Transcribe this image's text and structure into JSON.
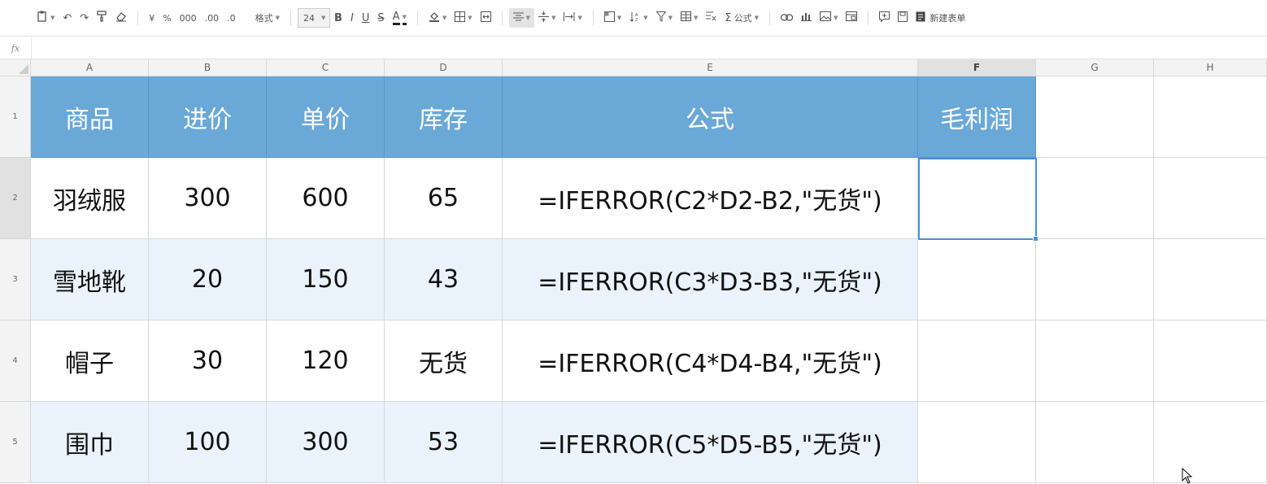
{
  "toolbar": {
    "currency": "¥",
    "percent": "%",
    "thousands": "000",
    "dec_inc": ".00",
    "dec_dec": ".0",
    "format_label": "格式",
    "font_size": "24",
    "bold": "B",
    "italic": "I",
    "underline": "U",
    "strike": "S",
    "font_color": "A",
    "formula_label": "公式",
    "new_sheet_label": "新建表单"
  },
  "formula_bar": {
    "fx": "fx",
    "content": ""
  },
  "columns": [
    "A",
    "B",
    "C",
    "D",
    "E",
    "F",
    "G",
    "H"
  ],
  "rows": [
    "1",
    "2",
    "3",
    "4",
    "5"
  ],
  "header_row": [
    "商品",
    "进价",
    "单价",
    "库存",
    "公式",
    "毛利润"
  ],
  "data_rows": [
    [
      "羽绒服",
      "300",
      "600",
      "65",
      "=IFERROR(C2*D2-B2,\"无货\")",
      ""
    ],
    [
      "雪地靴",
      "20",
      "150",
      "43",
      "=IFERROR(C3*D3-B3,\"无货\")",
      ""
    ],
    [
      "帽子",
      "30",
      "120",
      "无货",
      "=IFERROR(C4*D4-B4,\"无货\")",
      ""
    ],
    [
      "围巾",
      "100",
      "300",
      "53",
      "=IFERROR(C5*D5-B5,\"无货\")",
      ""
    ]
  ],
  "selected_cell": "F2",
  "colors": {
    "header_fill": "#6aa8d8",
    "band_fill": "#eaf2fb",
    "selection": "#4a8fd9"
  }
}
